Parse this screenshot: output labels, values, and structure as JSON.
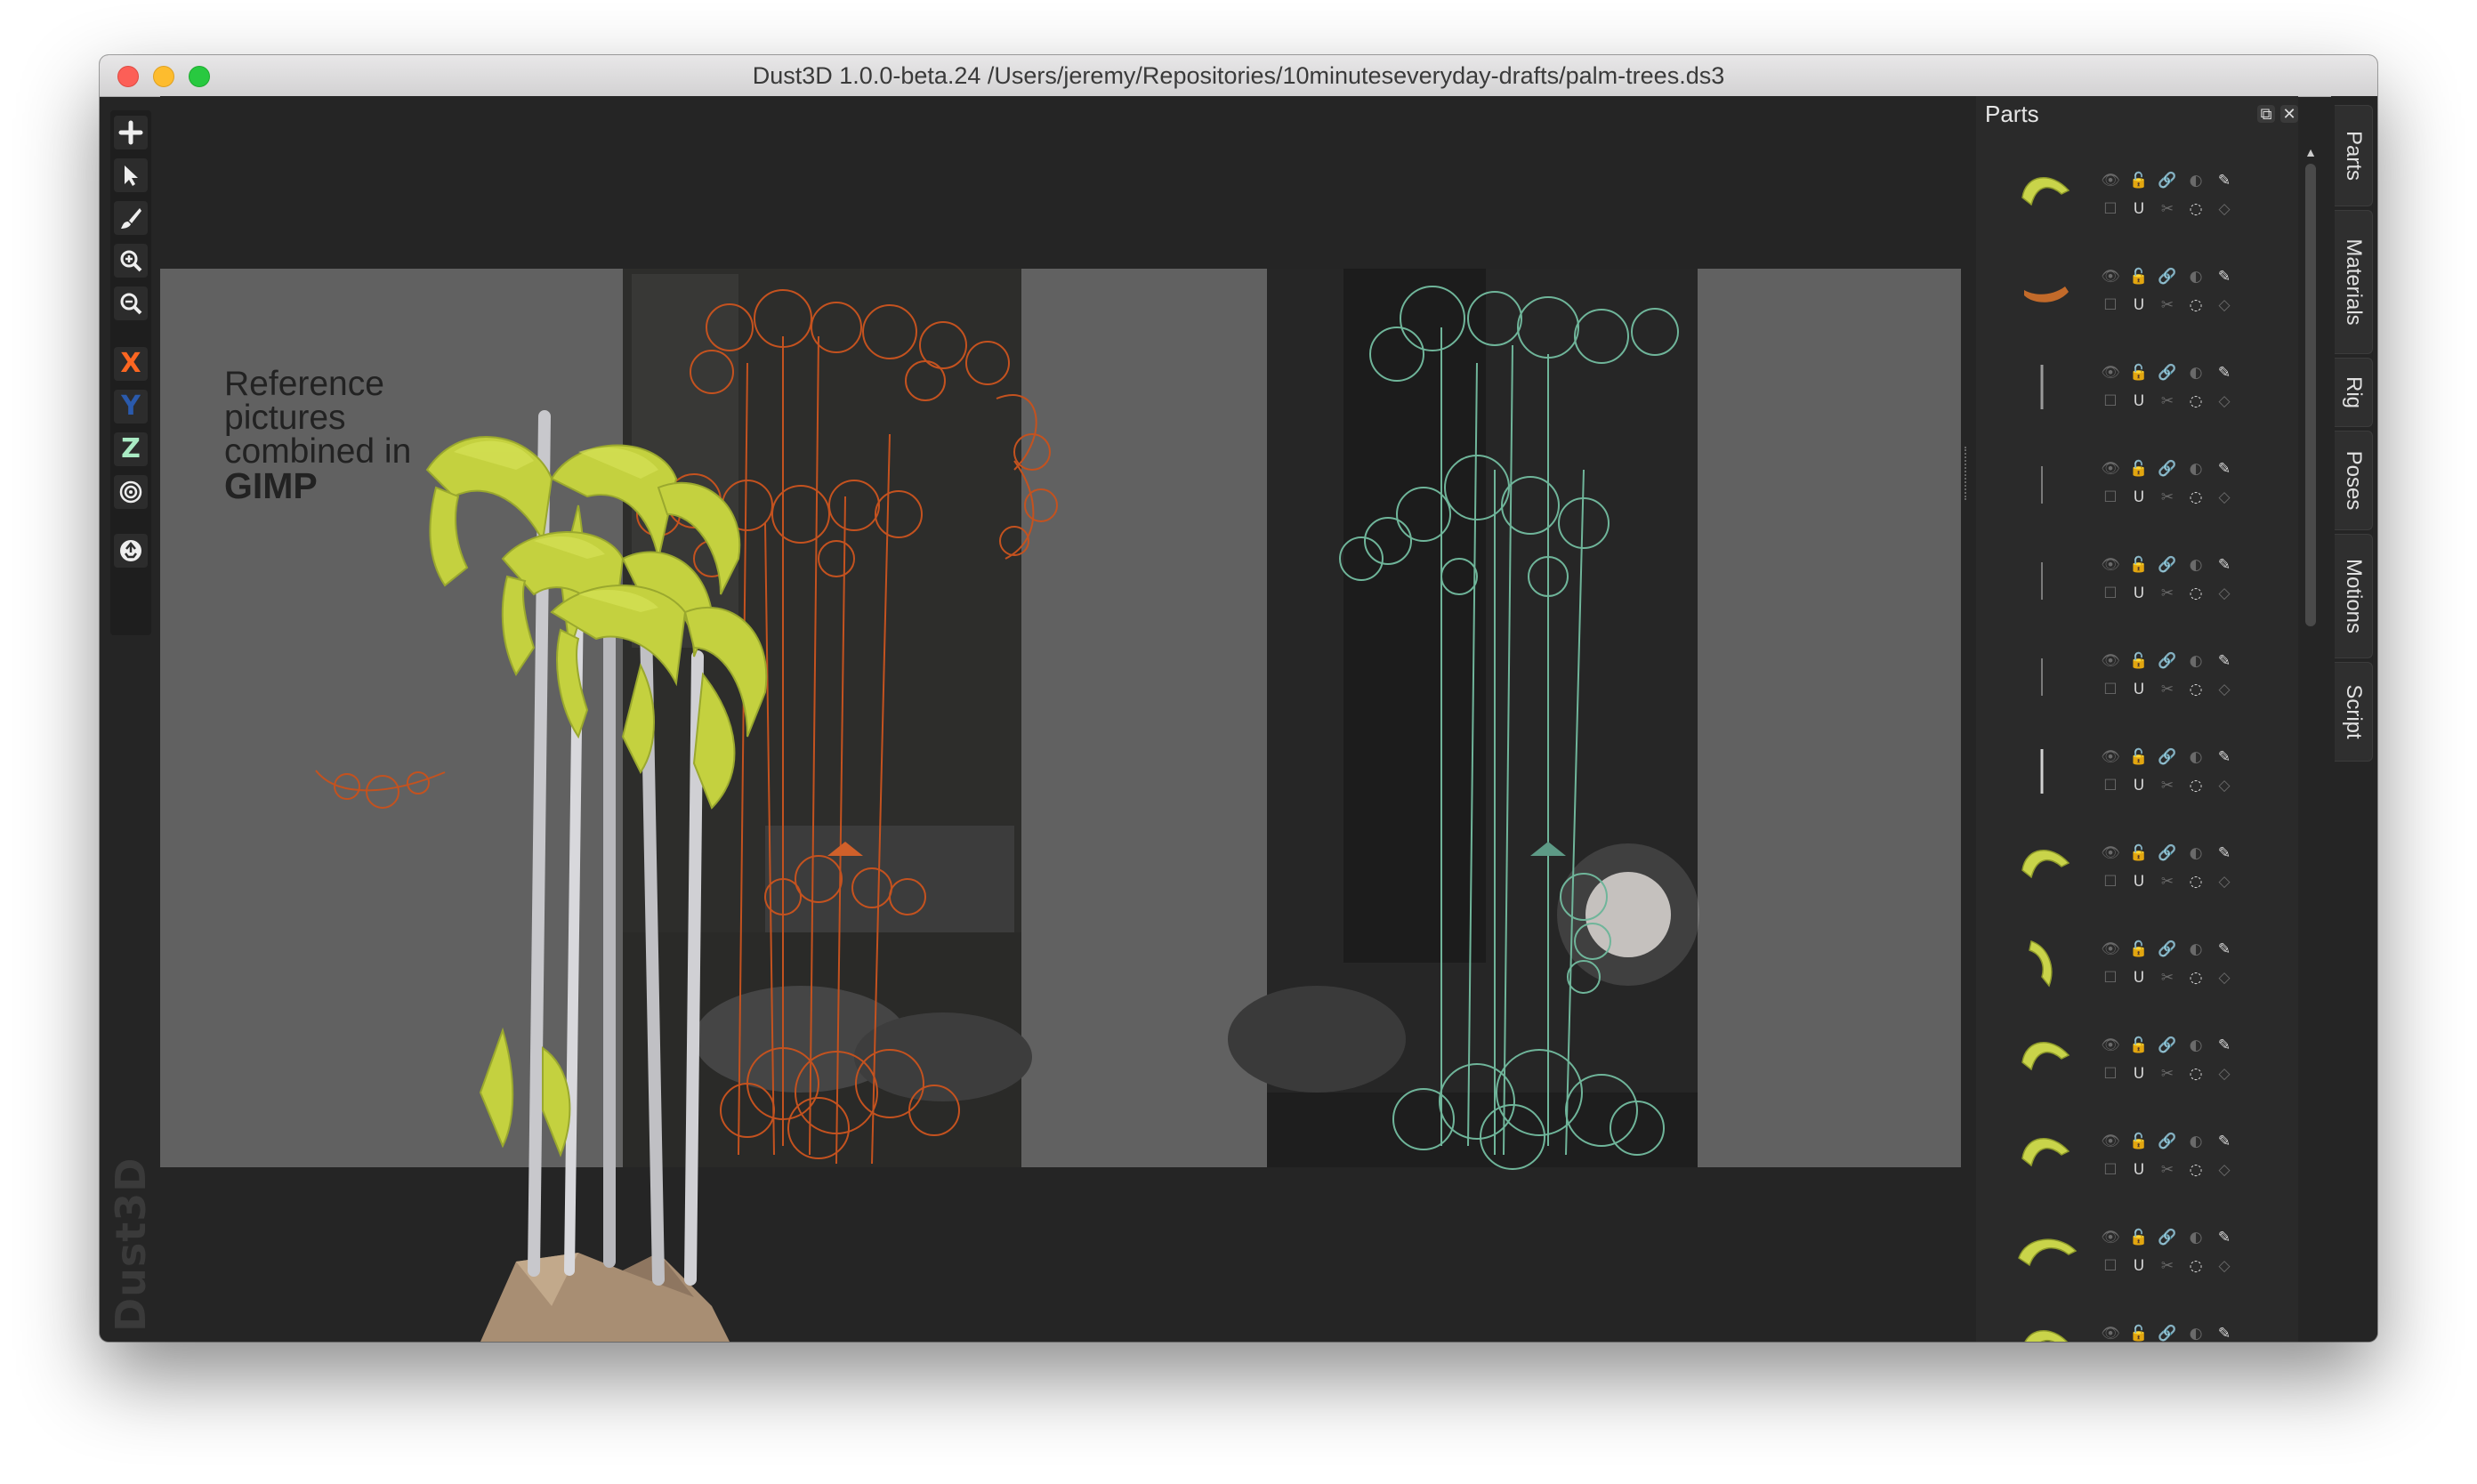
{
  "window": {
    "title": "Dust3D 1.0.0-beta.24 /Users/jeremy/Repositories/10minuteseveryday-drafts/palm-trees.ds3"
  },
  "toolbar": {
    "tools": [
      {
        "name": "add",
        "glyph": "+"
      },
      {
        "name": "select",
        "glyph": "arrow"
      },
      {
        "name": "paint",
        "glyph": "brush"
      },
      {
        "name": "zoom-in",
        "glyph": "zoom-in"
      },
      {
        "name": "zoom-out",
        "glyph": "zoom-out"
      }
    ],
    "axis_x": "X",
    "axis_y": "Y",
    "axis_z": "Z",
    "axis_colors": {
      "x": "#fc6621",
      "y": "#2a5aac",
      "z": "#aaebc4"
    }
  },
  "watermark": "Dust3D",
  "reference_image": {
    "caption_lines": [
      "Reference",
      "pictures",
      "combined in"
    ],
    "caption_bold": "GIMP"
  },
  "parts_panel": {
    "title": "Parts",
    "parts": [
      {
        "shape": "leaf-arc",
        "color": "#c9d44a"
      },
      {
        "shape": "rock",
        "color": "#c26a2a"
      },
      {
        "shape": "trunk",
        "color": "#9a9a9a"
      },
      {
        "shape": "trunk-thin",
        "color": "#7a7a7a"
      },
      {
        "shape": "trunk-thin",
        "color": "#7a7a7a"
      },
      {
        "shape": "trunk-thin",
        "color": "#7a7a7a"
      },
      {
        "shape": "trunk",
        "color": "#d0d0d0"
      },
      {
        "shape": "leaf-arc",
        "color": "#c9d44a"
      },
      {
        "shape": "leaf-hook",
        "color": "#c9d44a"
      },
      {
        "shape": "leaf-arc",
        "color": "#c9d44a"
      },
      {
        "shape": "leaf-arc",
        "color": "#c9d44a"
      },
      {
        "shape": "leaf-wide",
        "color": "#c9d44a"
      },
      {
        "shape": "leaf-arc",
        "color": "#c9d44a"
      }
    ]
  },
  "side_tabs": [
    "Parts",
    "Materials",
    "Rig",
    "Poses",
    "Motions",
    "Script"
  ]
}
